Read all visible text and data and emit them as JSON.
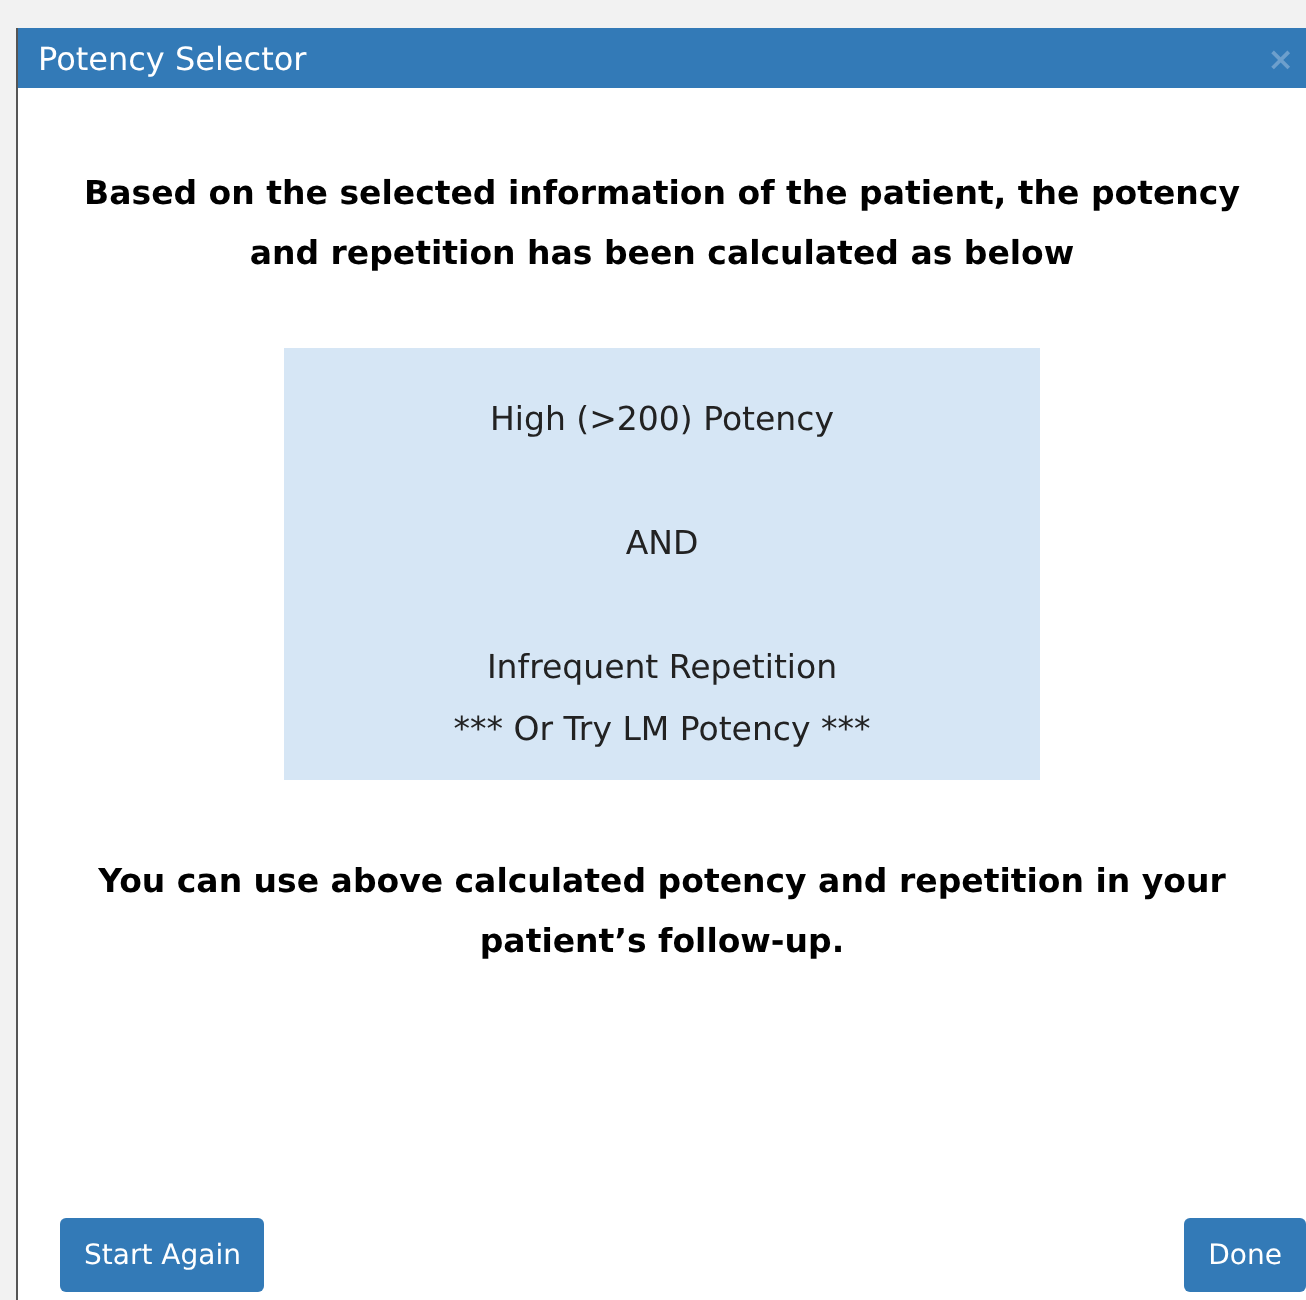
{
  "window": {
    "title": "Potency Selector",
    "close": "×"
  },
  "intro": "Based on the selected information of the patient, the potency and repetition has been calculated as below",
  "result": {
    "lines": [
      "High (>200) Potency",
      "AND",
      "Infrequent Repetition",
      "*** Or Try LM Potency ***"
    ]
  },
  "footer_text": "You can use above calculated potency and repetition in your patient’s follow-up.",
  "buttons": [
    {
      "label": "Start Again"
    },
    {
      "label": "Done"
    }
  ]
}
